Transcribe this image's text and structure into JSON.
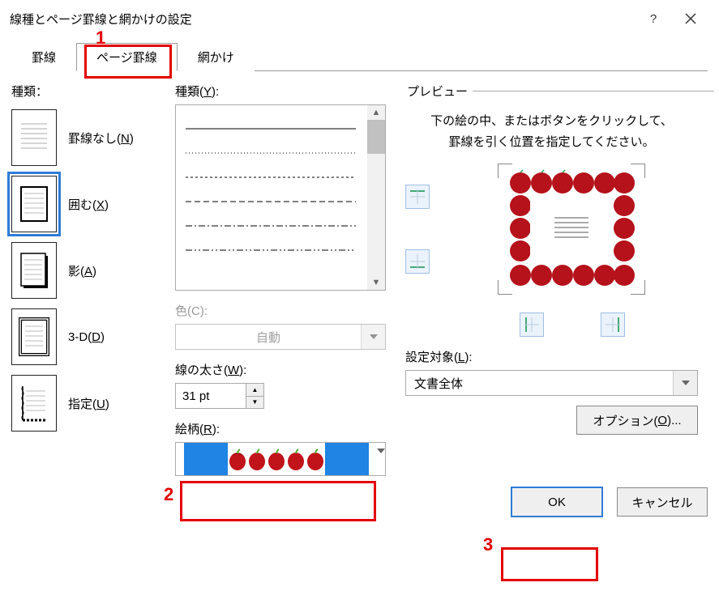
{
  "window": {
    "title": "線種とページ罫線と網かけの設定"
  },
  "tabs": {
    "border": "罫線",
    "page_border": "ページ罫線",
    "shading": "網かけ"
  },
  "annotations": {
    "n1": "1",
    "n2": "2",
    "n3": "3"
  },
  "left": {
    "section": "種類：",
    "items": {
      "none": {
        "label": "罫線なし(",
        "key": "N",
        "suffix": ")"
      },
      "box": {
        "label": "囲む(",
        "key": "X",
        "suffix": ")"
      },
      "shadow": {
        "label": "影(",
        "key": "A",
        "suffix": ")"
      },
      "threed": {
        "label": "3-D(",
        "key": "D",
        "suffix": ")"
      },
      "custom": {
        "label": "指定(",
        "key": "U",
        "suffix": ")"
      }
    }
  },
  "mid": {
    "style_label_pre": "種類(",
    "style_key": "Y",
    "style_label_post": "):",
    "color_label_pre": "色(",
    "color_key": "C",
    "color_label_post": "):",
    "color_value": "自動",
    "width_label_pre": "線の太さ(",
    "width_key": "W",
    "width_label_post": "):",
    "width_value": "31 pt",
    "art_label_pre": "絵柄(",
    "art_key": "R",
    "art_label_post": "):"
  },
  "right": {
    "legend": "プレビュー",
    "hint": "下の絵の中、またはボタンをクリックして、罫線を引く位置を指定してください。",
    "apply_label_pre": "設定対象(",
    "apply_key": "L",
    "apply_label_post": "):",
    "apply_value": "文書全体",
    "options_pre": "オプション(",
    "options_key": "O",
    "options_post": ")..."
  },
  "buttons": {
    "ok": "OK",
    "cancel": "キャンセル"
  }
}
